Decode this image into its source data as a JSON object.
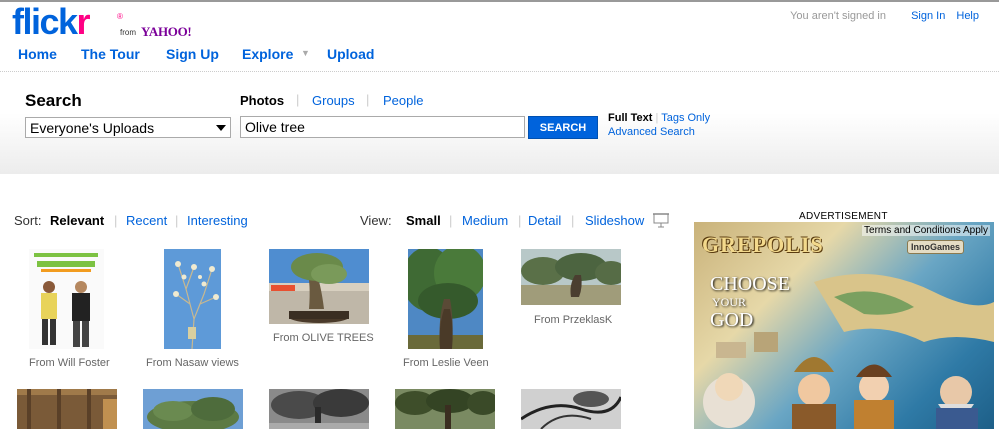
{
  "header": {
    "logo_main": "flick",
    "logo_r": "r",
    "logo_reg": "®",
    "from": "from",
    "yahoo": "YAHOO!",
    "signed_out": "You aren't signed in",
    "sign_in": "Sign In",
    "help": "Help"
  },
  "nav": {
    "home": "Home",
    "tour": "The Tour",
    "signup": "Sign Up",
    "explore": "Explore",
    "upload": "Upload"
  },
  "search": {
    "title": "Search",
    "scope": "Everyone's Uploads",
    "tab_photos": "Photos",
    "tab_groups": "Groups",
    "tab_people": "People",
    "query": "Olive tree",
    "button": "SEARCH",
    "full_text": "Full Text",
    "tags_only": "Tags Only",
    "advanced": "Advanced Search"
  },
  "sort": {
    "label": "Sort:",
    "relevant": "Relevant",
    "recent": "Recent",
    "interesting": "Interesting"
  },
  "view": {
    "label": "View:",
    "small": "Small",
    "medium": "Medium",
    "detail": "Detail",
    "slideshow": "Slideshow"
  },
  "results": [
    {
      "caption": "From Will Foster",
      "icon": "photo-people-promo"
    },
    {
      "caption": "From Nasaw views",
      "icon": "photo-blossom-tree"
    },
    {
      "caption": "From OLIVE TREES",
      "icon": "photo-olive-pot"
    },
    {
      "caption": "From Leslie Veen",
      "icon": "photo-olive-trunk"
    },
    {
      "caption": "From PrzeklasK",
      "icon": "photo-olive-grove"
    }
  ],
  "ad": {
    "label": "ADVERTISEMENT",
    "terms": "Terms and Conditions Apply",
    "brand": "GREPOLIS",
    "inno": "InnoGames",
    "line1": "CHOOSE",
    "line2": "YOUR",
    "line3": "GOD"
  },
  "colors": {
    "link": "#0063dc",
    "logo_pink": "#ff0084",
    "search_button": "#0063dc"
  }
}
